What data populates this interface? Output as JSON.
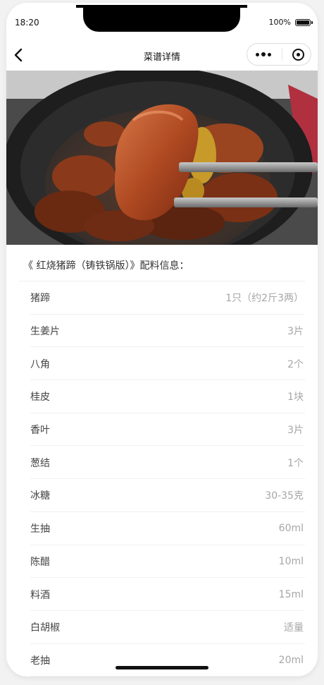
{
  "status_bar": {
    "time": "18:20",
    "battery": "100%"
  },
  "navbar": {
    "title": "菜谱详情"
  },
  "recipe": {
    "section_title": "《 红烧猪蹄（铸铁锅版）》配料信息：",
    "ingredients": [
      {
        "name": "猪蹄",
        "qty": "1只（约2斤3两）"
      },
      {
        "name": "生姜片",
        "qty": "3片"
      },
      {
        "name": "八角",
        "qty": "2个"
      },
      {
        "name": "桂皮",
        "qty": "1块"
      },
      {
        "name": "香叶",
        "qty": "3片"
      },
      {
        "name": "葱结",
        "qty": "1个"
      },
      {
        "name": "冰糖",
        "qty": "30-35克"
      },
      {
        "name": "生抽",
        "qty": "60ml"
      },
      {
        "name": "陈醋",
        "qty": "10ml"
      },
      {
        "name": "料酒",
        "qty": "15ml"
      },
      {
        "name": "白胡椒",
        "qty": "适量"
      },
      {
        "name": "老抽",
        "qty": "20ml"
      }
    ]
  },
  "icons": {
    "back": "chevron-left-icon",
    "more": "more-dots-icon",
    "close": "target-circle-icon"
  }
}
